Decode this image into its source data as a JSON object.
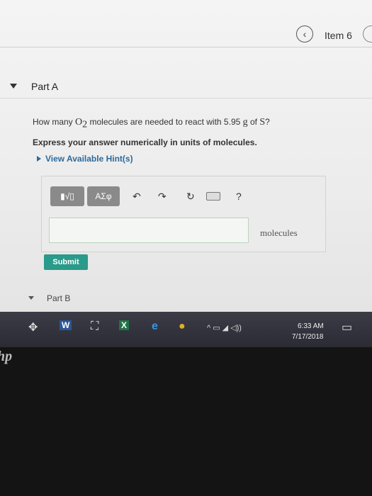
{
  "header": {
    "prev_icon": "chevron-left-icon",
    "prev_glyph": "‹",
    "item_label": "Item 6"
  },
  "partA": {
    "title": "Part A",
    "question": {
      "prefix": "How many ",
      "molecule": "O",
      "subscript": "2",
      "middle": " molecules are needed to react with 5.95 ",
      "unit": "g",
      "of": " of ",
      "element": "S",
      "suffix": "?"
    },
    "instruction": "Express your answer numerically in units of molecules.",
    "hints_label": "View Available Hint(s)",
    "toolbar": {
      "template_glyph": "▮√▯",
      "symbols_label": "ΑΣφ",
      "undo_glyph": "↶",
      "redo_glyph": "↷",
      "reset_glyph": "↻",
      "help_glyph": "?"
    },
    "answer_value": "",
    "units": "molecules",
    "submit_label": "Submit"
  },
  "partB": {
    "title": "Part B"
  },
  "taskbar": {
    "icons": {
      "dropbox": "✥",
      "word": "W",
      "store": "⛶",
      "excel": "X",
      "edge": "e",
      "chrome": "●",
      "tray": "^ ▭ ◢ ◁))",
      "notifications": "▭"
    },
    "time": "6:33 AM",
    "date": "7/17/2018"
  },
  "bezel": {
    "logo_text": "hp"
  }
}
